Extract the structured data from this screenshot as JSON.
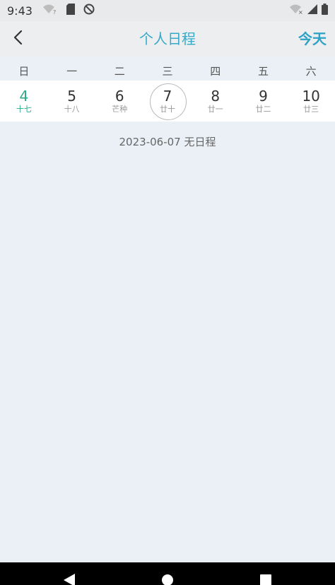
{
  "status_bar": {
    "time": "9:43",
    "left_icons": [
      "wifi-question-icon",
      "sd-card-icon",
      "no-disturb-icon"
    ],
    "right_icons": [
      "wifi-off-icon",
      "signal-icon",
      "battery-icon"
    ]
  },
  "header": {
    "title": "个人日程",
    "today_label": "今天",
    "accent_color": "#36a9c9"
  },
  "calendar": {
    "weekdays": [
      "日",
      "一",
      "二",
      "三",
      "四",
      "五",
      "六"
    ],
    "dates": [
      {
        "day": "4",
        "lunar": "十七",
        "state": "today"
      },
      {
        "day": "5",
        "lunar": "十八",
        "state": "normal"
      },
      {
        "day": "6",
        "lunar": "芒种",
        "state": "normal"
      },
      {
        "day": "7",
        "lunar": "廿十",
        "state": "selected"
      },
      {
        "day": "8",
        "lunar": "廿一",
        "state": "normal"
      },
      {
        "day": "9",
        "lunar": "廿二",
        "state": "normal"
      },
      {
        "day": "10",
        "lunar": "廿三",
        "state": "normal"
      }
    ],
    "today_color": "#2aa889"
  },
  "schedule": {
    "empty_message": "2023-06-07 无日程"
  },
  "nav_bar": {
    "icons": [
      "back-triangle-icon",
      "home-circle-icon",
      "recents-square-icon"
    ]
  }
}
